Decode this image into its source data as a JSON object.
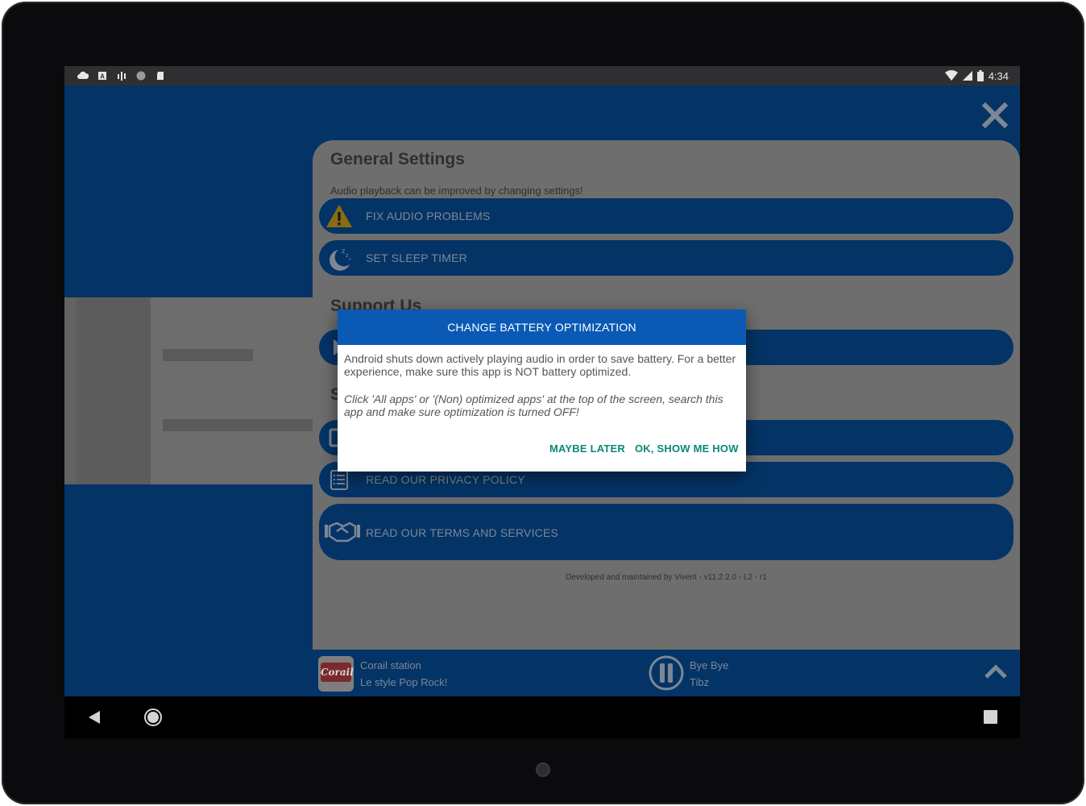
{
  "status_bar": {
    "time": "4:34",
    "left_icons": [
      "cloud-icon",
      "a-box-icon",
      "signal-bars-icon",
      "dot-icon",
      "sd-card-icon"
    ],
    "right_icons": [
      "wifi-icon",
      "cell-signal-icon",
      "battery-icon"
    ]
  },
  "settings": {
    "title": "General Settings",
    "subtitle": "Audio playback can be improved by changing settings!",
    "items": [
      {
        "label": "FIX AUDIO PROBLEMS",
        "icon": "warning-icon"
      },
      {
        "label": "SET SLEEP TIMER",
        "icon": "moon-sleep-icon"
      }
    ]
  },
  "support": {
    "title": "Support Us",
    "partial_label": "S",
    "items": [
      {
        "label": "READ OUR PRIVACY POLICY",
        "icon": "list-icon"
      },
      {
        "label": "READ OUR TERMS AND SERVICES",
        "icon": "handshake-icon"
      }
    ]
  },
  "footer": "Developed and maintained by Viverit - v11.2.2.0 - L2 - r1",
  "player": {
    "station_name": "Corail station",
    "station_tagline": "Le style Pop Rock!",
    "logo_text": "Corail",
    "song_title": "Bye Bye",
    "song_artist": "Tibz"
  },
  "dialog": {
    "title": "CHANGE BATTERY OPTIMIZATION",
    "body": "Android shuts down actively playing audio in order to save battery. For a better experience, make sure this app is NOT battery optimized.",
    "instructions": "Click 'All apps' or '(Non) optimized apps' at the top of the screen, search this app and make sure optimization is turned OFF!",
    "secondary_button": "MAYBE LATER",
    "primary_button": "OK, SHOW ME HOW"
  },
  "colors": {
    "dim_blue": "#043466",
    "dialog_header": "#0a5ab5",
    "button_teal": "#098a76"
  }
}
